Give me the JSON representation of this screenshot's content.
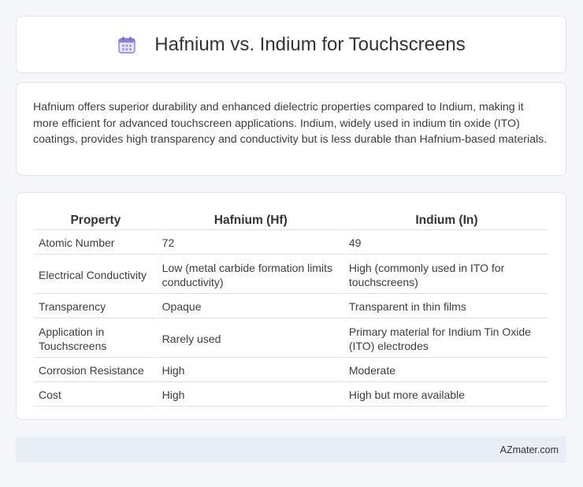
{
  "header": {
    "title": "Hafnium vs. Indium for Touchscreens",
    "icon": "calendar-icon",
    "icon_color": "#8b7fd8"
  },
  "summary": {
    "text": "Hafnium offers superior durability and enhanced dielectric properties compared to Indium, making it more efficient for advanced touchscreen applications. Indium, widely used in indium tin oxide (ITO) coatings, provides high transparency and conductivity but is less durable than Hafnium-based materials."
  },
  "table": {
    "headers": [
      "Property",
      "Hafnium (Hf)",
      "Indium (In)"
    ],
    "rows": [
      [
        "Atomic Number",
        "72",
        "49"
      ],
      [
        "Electrical Conductivity",
        "Low (metal carbide formation limits conductivity)",
        "High (commonly used in ITO for touchscreens)"
      ],
      [
        "Transparency",
        "Opaque",
        "Transparent in thin films"
      ],
      [
        "Application in Touchscreens",
        "Rarely used",
        "Primary material for Indium Tin Oxide (ITO) electrodes"
      ],
      [
        "Corrosion Resistance",
        "High",
        "Moderate"
      ],
      [
        "Cost",
        "High",
        "High but more available"
      ]
    ]
  },
  "footer": {
    "text": "AZmater.com"
  }
}
